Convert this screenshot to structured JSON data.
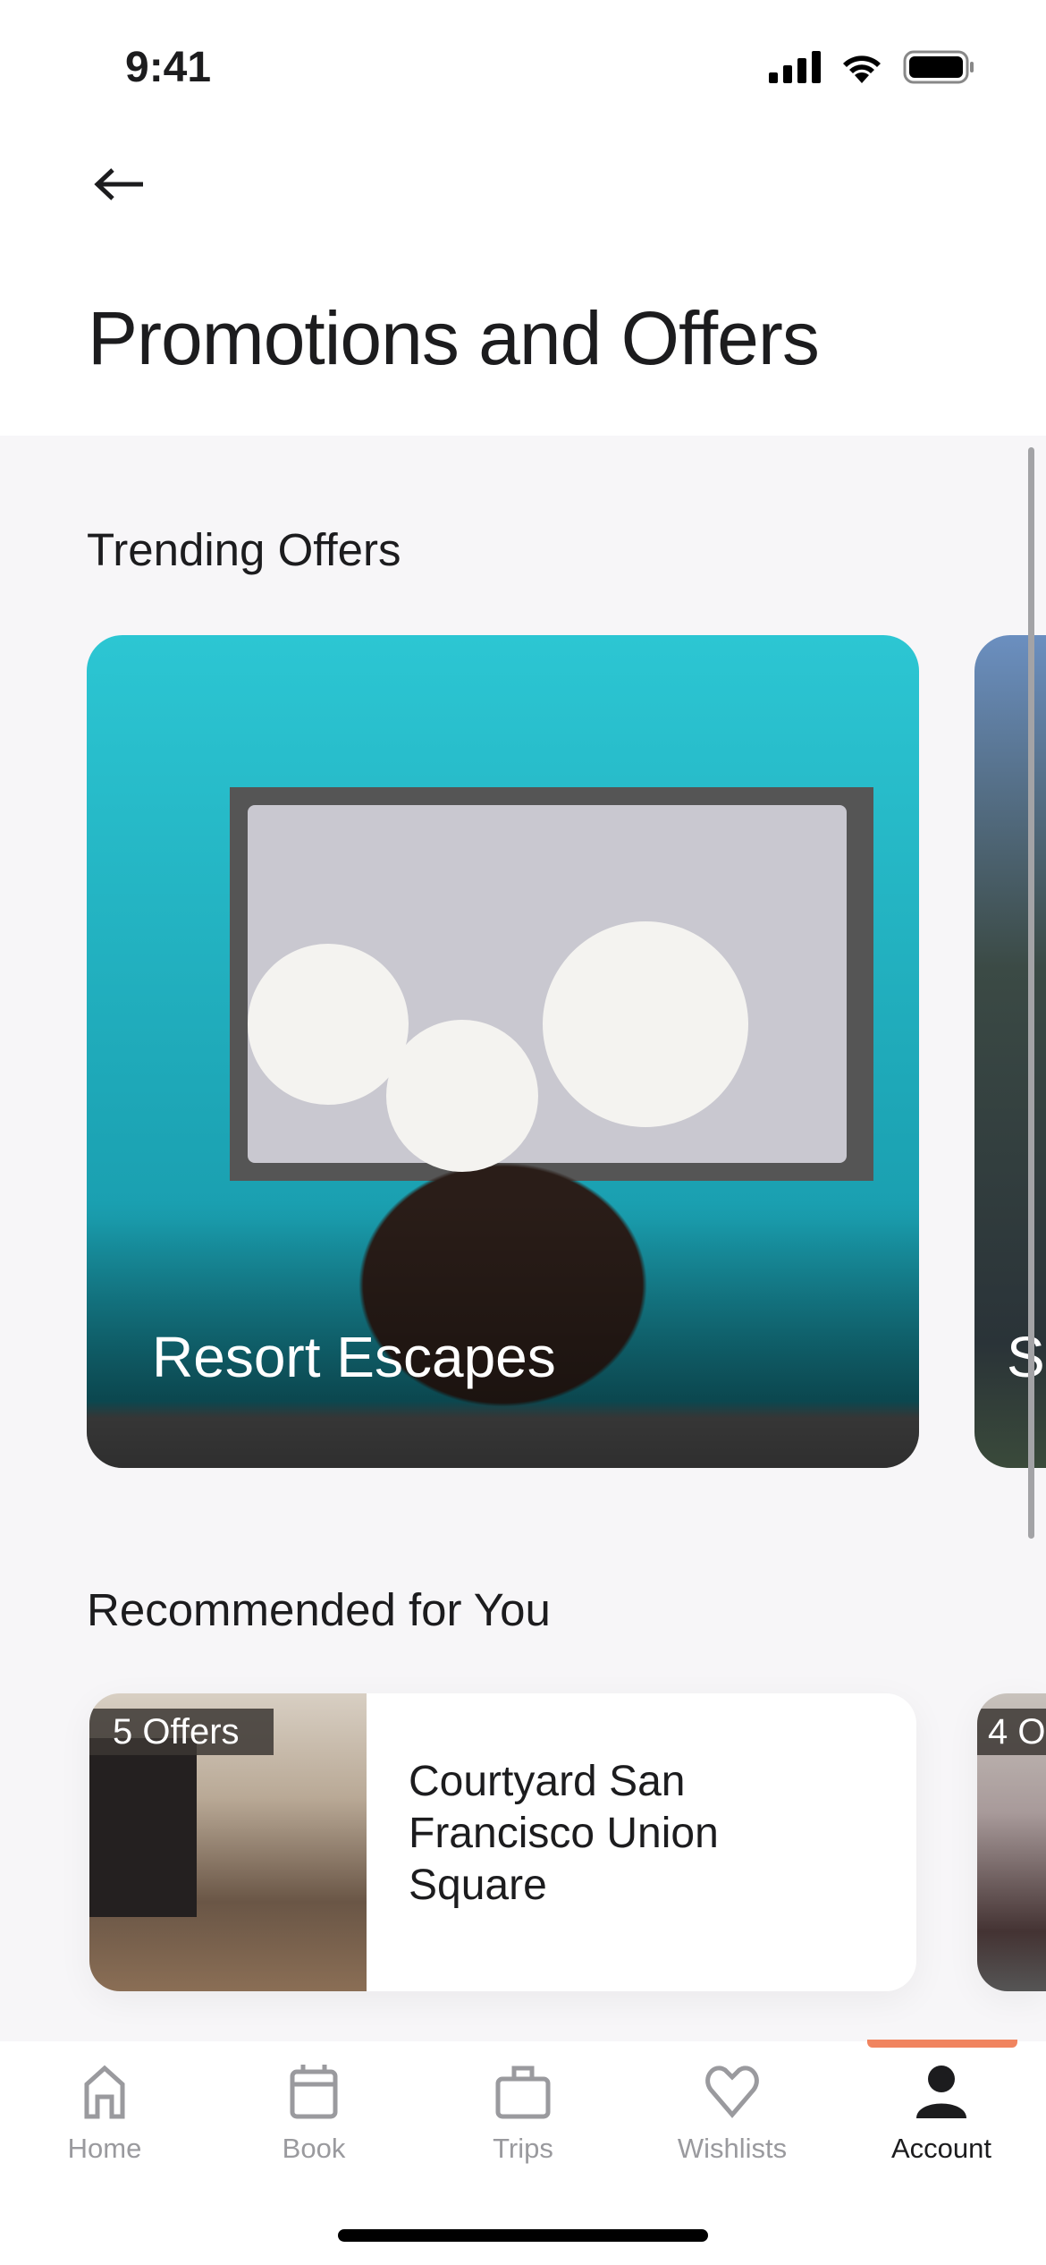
{
  "status_bar": {
    "time": "9:41"
  },
  "header": {
    "title": "Promotions and Offers",
    "back_icon": "arrow-left-icon"
  },
  "trending": {
    "title": "Trending Offers",
    "cards": [
      {
        "label": "Resort Escapes"
      },
      {
        "label": "S"
      }
    ]
  },
  "recommended": {
    "title": "Recommended for You",
    "cards": [
      {
        "badge": "5 Offers",
        "name": "Courtyard San Francisco Union Square"
      },
      {
        "badge": "4 O"
      }
    ]
  },
  "nav": {
    "active_color": "#f0845f",
    "items": [
      {
        "label": "Home",
        "icon": "home-icon"
      },
      {
        "label": "Book",
        "icon": "calendar-icon"
      },
      {
        "label": "Trips",
        "icon": "suitcase-icon"
      },
      {
        "label": "Wishlists",
        "icon": "heart-icon"
      },
      {
        "label": "Account",
        "icon": "person-icon",
        "active": true
      }
    ]
  }
}
